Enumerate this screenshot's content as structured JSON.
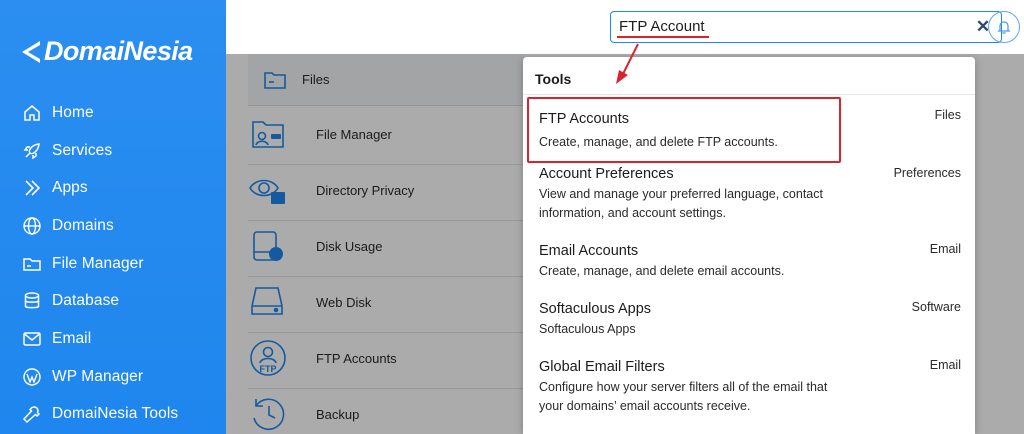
{
  "brand": {
    "name": "DomaiNesia"
  },
  "sidebar": {
    "items": [
      {
        "label": "Home",
        "icon": "home-icon"
      },
      {
        "label": "Services",
        "icon": "rocket-icon"
      },
      {
        "label": "Apps",
        "icon": "chevrons-right-icon"
      },
      {
        "label": "Domains",
        "icon": "globe-icon"
      },
      {
        "label": "File Manager",
        "icon": "folder-icon"
      },
      {
        "label": "Database",
        "icon": "database-icon"
      },
      {
        "label": "Email",
        "icon": "mail-icon"
      },
      {
        "label": "WP Manager",
        "icon": "wordpress-icon"
      },
      {
        "label": "DomaiNesia Tools",
        "icon": "tools-icon"
      }
    ]
  },
  "search": {
    "value": "FTP Account",
    "clear_icon": "close-icon"
  },
  "main": {
    "section_title": "Files",
    "tools": [
      {
        "label": "File Manager",
        "icon": "file-manager-icon"
      },
      {
        "label": "Directory Privacy",
        "icon": "directory-privacy-icon"
      },
      {
        "label": "Disk Usage",
        "icon": "disk-usage-icon"
      },
      {
        "label": "Web Disk",
        "icon": "web-disk-icon"
      },
      {
        "label": "FTP Accounts",
        "icon": "ftp-accounts-icon",
        "badge": "FTP"
      },
      {
        "label": "Backup",
        "icon": "backup-icon"
      }
    ]
  },
  "dropdown": {
    "header": "Tools",
    "results": [
      {
        "title": "FTP Accounts",
        "desc": "Create, manage, and delete FTP accounts.",
        "category": "Files"
      },
      {
        "title": "Account Preferences",
        "desc": "View and manage your preferred language, contact information, and account settings.",
        "category": "Preferences"
      },
      {
        "title": "Email Accounts",
        "desc": "Create, manage, and delete email accounts.",
        "category": "Email"
      },
      {
        "title": "Softaculous Apps",
        "desc": "Softaculous Apps",
        "category": "Software"
      },
      {
        "title": "Global Email Filters",
        "desc": "Configure how your server filters all of the email that your domains’ email accounts receive.",
        "category": "Email"
      }
    ]
  },
  "colors": {
    "sidebar": "#1e86ee",
    "accent": "#1e86ee",
    "highlight": "#d9232d"
  }
}
